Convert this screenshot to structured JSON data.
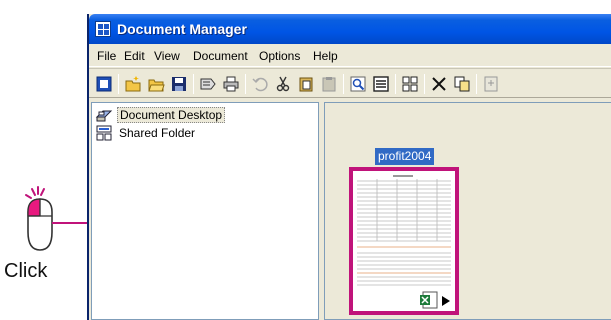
{
  "window": {
    "title": "Document Manager"
  },
  "menubar": {
    "items": [
      "File",
      "Edit",
      "View",
      "Document",
      "Options",
      "Help"
    ]
  },
  "toolbar": {
    "buttons": [
      "new-document-icon",
      "new-folder-icon",
      "open-icon",
      "save-icon",
      "send-icon",
      "print-icon",
      "undo-icon",
      "cut-icon",
      "copy-icon",
      "paste-icon",
      "search-icon",
      "properties-icon",
      "thumbnails-icon",
      "delete-icon",
      "duplicate-icon",
      "export-icon"
    ]
  },
  "tree": {
    "items": [
      {
        "label": "Document Desktop",
        "icon": "desktop-icon",
        "selected": true
      },
      {
        "label": "Shared Folder",
        "icon": "shared-folder-icon",
        "selected": false
      }
    ]
  },
  "document": {
    "name": "profit2004",
    "selected": true,
    "badge_icon": "excel-icon"
  },
  "annotation": {
    "action": "Click",
    "accent_color": "#c0137a"
  }
}
